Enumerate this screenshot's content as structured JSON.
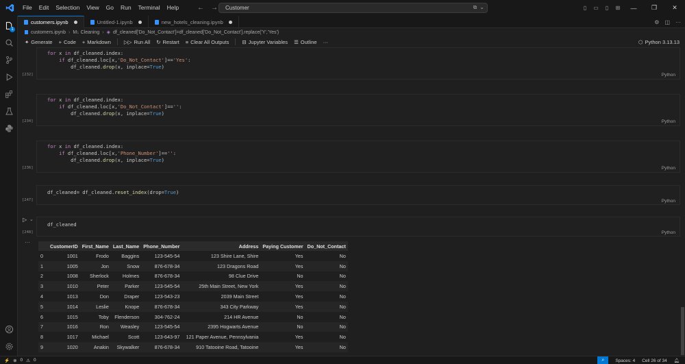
{
  "menu": [
    "File",
    "Edit",
    "Selection",
    "View",
    "Go",
    "Run",
    "Terminal",
    "Help"
  ],
  "command_center": {
    "text": "Customer"
  },
  "tabs": [
    {
      "label": "customers.ipynb",
      "active": true,
      "modified": true
    },
    {
      "label": "Untitled-1.ipynb",
      "active": false,
      "modified": true
    },
    {
      "label": "new_hotels_cleaning.ipynb",
      "active": false,
      "modified": true
    }
  ],
  "breadcrumb": [
    "customers.ipynb",
    "M↓ Cleaning",
    "df_cleaned['Do_Not_Contact']=df_cleaned['Do_Not_Contact'].replace('Y','Yes')"
  ],
  "toolbar": {
    "generate": "Generate",
    "code": "Code",
    "markdown": "Markdown",
    "run_all": "Run All",
    "restart": "Restart",
    "clear_outputs": "Clear All Outputs",
    "variables": "Jupyter Variables",
    "outline": "Outline",
    "kernel": "Python 3.13.13"
  },
  "cells": [
    {
      "exec": "[232]",
      "lang": "Python"
    },
    {
      "exec": "[234]",
      "lang": "Python"
    },
    {
      "exec": "[236]",
      "lang": "Python"
    },
    {
      "exec": "[247]",
      "lang": "Python"
    },
    {
      "exec": "[248]",
      "lang": "Python"
    }
  ],
  "table": {
    "columns": [
      "",
      "CustomerID",
      "First_Name",
      "Last_Name",
      "Phone_Number",
      "Address",
      "Paying Customer",
      "Do_Not_Contact"
    ],
    "rows": [
      [
        "0",
        "1001",
        "Frodo",
        "Baggins",
        "123-545-54",
        "123 Shire Lane, Shire",
        "Yes",
        "No"
      ],
      [
        "1",
        "1005",
        "Jon",
        "Snow",
        "876-678-34",
        "123 Dragons Road",
        "Yes",
        "No"
      ],
      [
        "2",
        "1008",
        "Sherlock",
        "Holmes",
        "876-678-34",
        "98 Clue Drive",
        "No",
        "No"
      ],
      [
        "3",
        "1010",
        "Peter",
        "Parker",
        "123-545-54",
        "25th Main Street, New York",
        "Yes",
        "No"
      ],
      [
        "4",
        "1013",
        "Don",
        "Draper",
        "123-543-23",
        "2039 Main Street",
        "Yes",
        "No"
      ],
      [
        "5",
        "1014",
        "Leslie",
        "Knope",
        "876-678-34",
        "343 City Parkway",
        "Yes",
        "No"
      ],
      [
        "6",
        "1015",
        "Toby",
        "Flenderson",
        "304-762-24",
        "214 HR Avenue",
        "No",
        "No"
      ],
      [
        "7",
        "1016",
        "Ron",
        "Weasley",
        "123-545-54",
        "2395 Hogwarts Avenue",
        "No",
        "No"
      ],
      [
        "8",
        "1017",
        "Michael",
        "Scott",
        "123-643-97",
        "121 Paper Avenue, Pennsylvania",
        "Yes",
        "No"
      ],
      [
        "9",
        "1020",
        "Anakin",
        "Skywalker",
        "876-678-34",
        "910 Tatooine Road, Tatooine",
        "Yes",
        "No"
      ]
    ]
  },
  "status": {
    "errors": "0",
    "warnings": "0",
    "spaces": "Spaces: 4",
    "cell": "Cell 26 of 34"
  },
  "colors": {
    "accent": "#0078d4",
    "keyword": "#c586c0",
    "function": "#dcdcaa",
    "string": "#ce9178",
    "constant": "#569cd6"
  }
}
